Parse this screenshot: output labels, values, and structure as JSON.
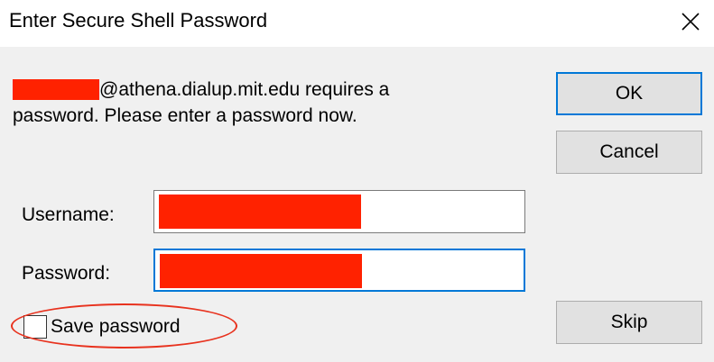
{
  "window": {
    "title": "Enter Secure Shell Password",
    "close_icon": "close-icon"
  },
  "message": {
    "host_suffix": "@athena.dialup.mit.edu requires a",
    "line2": "password.  Please enter a password now."
  },
  "buttons": {
    "ok": "OK",
    "cancel": "Cancel",
    "skip": "Skip"
  },
  "form": {
    "username_label": "Username:",
    "password_label": "Password:",
    "save_password_label": "Save password",
    "save_password_checked": false
  },
  "colors": {
    "redaction": "#ff2200",
    "focus_border": "#0078d7",
    "annotation": "#e8321e"
  }
}
